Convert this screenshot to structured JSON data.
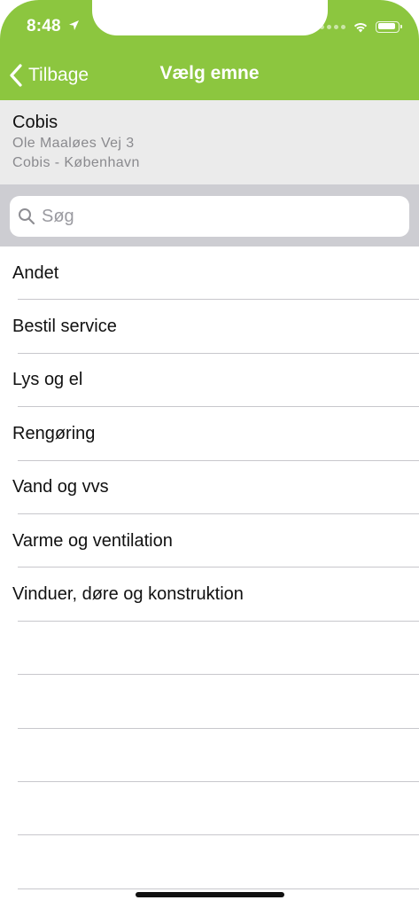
{
  "status_bar": {
    "time": "8:48",
    "battery_level": 0.95,
    "icons": [
      "location-arrow-icon",
      "cellular-dots-icon",
      "wifi-icon",
      "battery-icon"
    ]
  },
  "nav": {
    "back_label": "Tilbage",
    "title": "Vælg emne",
    "color": "#8cc63f"
  },
  "location": {
    "name": "Cobis",
    "address": "Ole Maaløes Vej 3",
    "city": "Cobis - København"
  },
  "search": {
    "placeholder": "Søg",
    "value": ""
  },
  "topics": [
    {
      "label": "Andet"
    },
    {
      "label": "Bestil service"
    },
    {
      "label": "Lys og el"
    },
    {
      "label": "Rengøring"
    },
    {
      "label": "Vand og vvs"
    },
    {
      "label": "Varme og ventilation"
    },
    {
      "label": "Vinduer, døre og konstruktion"
    }
  ]
}
